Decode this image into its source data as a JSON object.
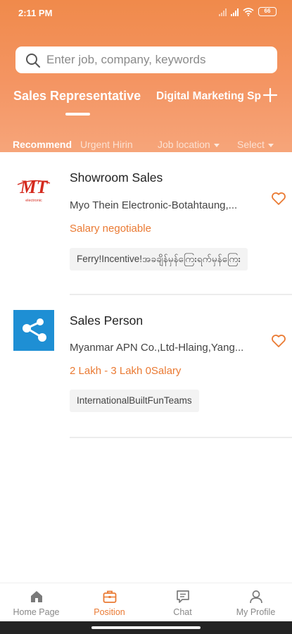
{
  "status_bar": {
    "time": "2:11 PM",
    "battery": "66"
  },
  "search": {
    "placeholder": "Enter job, company, keywords"
  },
  "tabs": [
    {
      "label": "Sales Representative",
      "active": true
    },
    {
      "label": "Digital Marketing Sp",
      "active": false
    }
  ],
  "filters": {
    "recommend": "Recommend",
    "urgent": "Urgent Hirin",
    "location": "Job location",
    "select": "Select"
  },
  "jobs": [
    {
      "title": "Showroom Sales",
      "company": "Myo Thein Electronic-Botahtaung,...",
      "salary": "Salary negotiable",
      "tags": "Ferry!Incentive!အခ​ချိန်မှန်​ကြေး​ရက်မှန်ကြေး",
      "logo_text": "MT",
      "logo_sub": "မျိုးသိန်း electronic"
    },
    {
      "title": "Sales Person",
      "company": "Myanmar APN Co.,Ltd-Hlaing,Yang...",
      "salary": "2 Lakh - 3 Lakh 0Salary",
      "tags": "InternationalBuiltFunTeams"
    }
  ],
  "bottom_nav": [
    {
      "label": "Home Page",
      "icon": "home-icon",
      "active": false
    },
    {
      "label": "Position",
      "icon": "briefcase-icon",
      "active": true
    },
    {
      "label": "Chat",
      "icon": "chat-icon",
      "active": false
    },
    {
      "label": "My Profile",
      "icon": "person-icon",
      "active": false
    }
  ],
  "colors": {
    "accent": "#ea7a33",
    "header": "#f28f56",
    "logo_blue": "#1e8fd4"
  }
}
